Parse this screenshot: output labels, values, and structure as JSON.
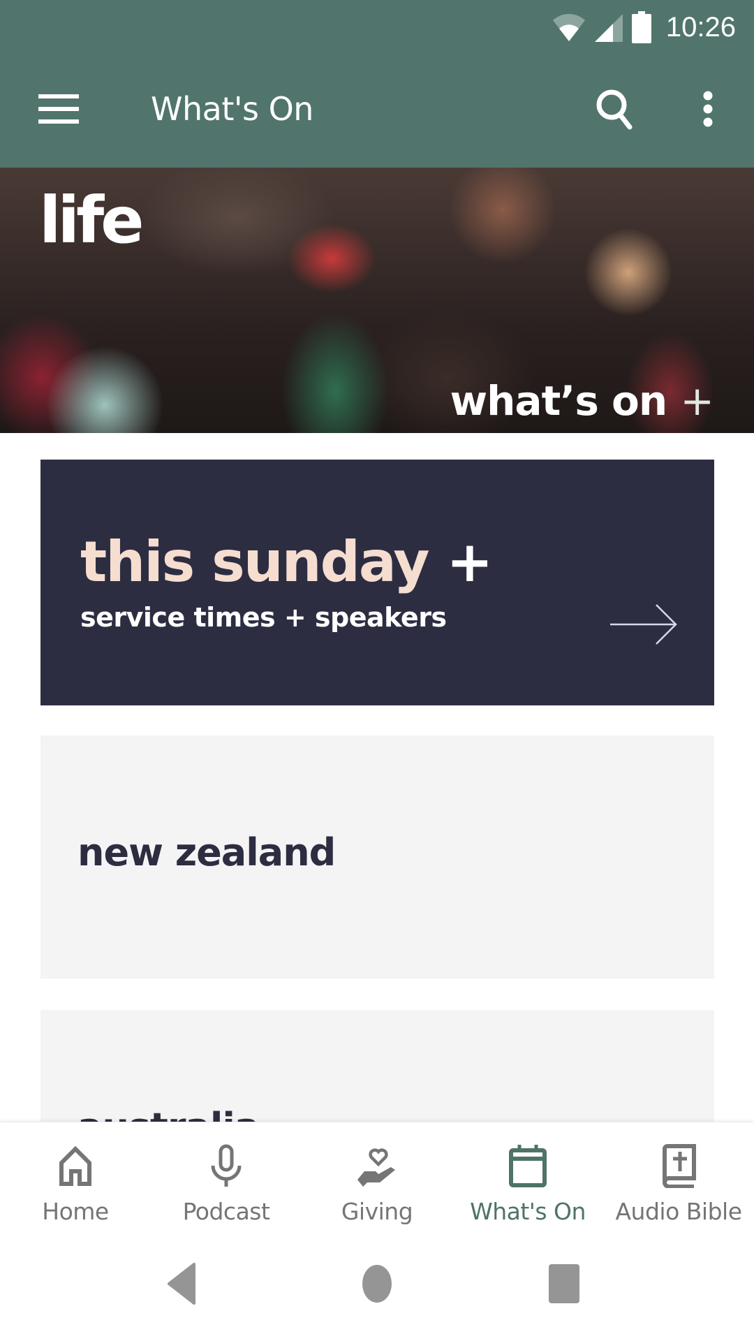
{
  "status_bar": {
    "time": "10:26",
    "icons": [
      "wifi-icon",
      "cellular-signal-icon",
      "battery-icon"
    ]
  },
  "app_bar": {
    "title": "What's On",
    "menu_icon": "hamburger-menu-icon",
    "search_icon": "search-icon",
    "more_icon": "more-vertical-icon"
  },
  "hero": {
    "logo": "life",
    "caption": "what’s on",
    "caption_suffix": "+"
  },
  "sunday_card": {
    "title": "this sunday",
    "title_suffix": "+",
    "subtitle": "service times + speakers",
    "arrow_icon": "arrow-right-icon"
  },
  "regions": [
    {
      "label": "new zealand"
    },
    {
      "label": "australia"
    }
  ],
  "bottom_nav": {
    "active": "What's On",
    "items": [
      {
        "label": "Home",
        "icon": "home-icon"
      },
      {
        "label": "Podcast",
        "icon": "microphone-icon"
      },
      {
        "label": "Giving",
        "icon": "giving-hand-heart-icon"
      },
      {
        "label": "What's On",
        "icon": "calendar-icon"
      },
      {
        "label": "Audio Bible",
        "icon": "bible-icon"
      }
    ]
  },
  "system_nav": {
    "back_icon": "back-triangle-icon",
    "home_icon": "home-circle-icon",
    "recents_icon": "recents-square-icon"
  },
  "colors": {
    "app_bar": "#51756C",
    "sunday_card_bg": "#2D2D42",
    "sunday_title": "#F5DDD0",
    "region_card_bg": "#F4F4F5",
    "region_text": "#2D2D42",
    "nav_active": "#4E7369",
    "nav_inactive": "#757575"
  }
}
